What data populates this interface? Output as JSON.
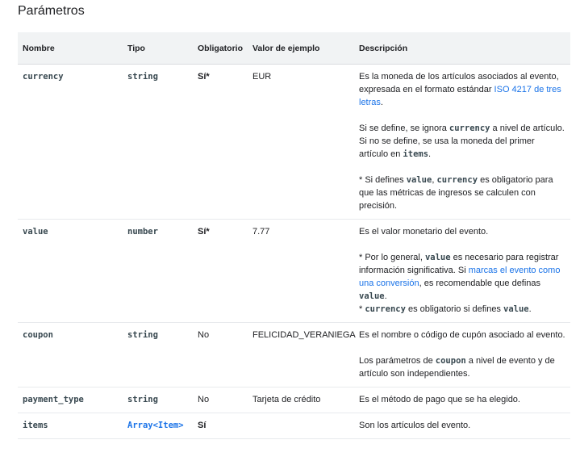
{
  "title": "Parámetros",
  "headers": {
    "name": "Nombre",
    "type": "Tipo",
    "required": "Obligatorio",
    "example": "Valor de ejemplo",
    "description": "Descripción"
  },
  "rows": [
    {
      "name": "currency",
      "type": "string",
      "required": "Sí*",
      "example": "EUR",
      "desc": {
        "p1_a": "Es la moneda de los artículos asociados al evento, expresada en el formato estándar ",
        "p1_link": "ISO 4217 de tres letras",
        "p1_b": ".",
        "p2_a": "Si se define, se ignora ",
        "p2_code1": "currency",
        "p2_b": " a nivel de artículo.",
        "p2_c": "Si no se define, se usa la moneda del primer artículo en ",
        "p2_code2": "items",
        "p2_d": ".",
        "p3_a": "* Si defines ",
        "p3_code1": "value",
        "p3_b": ", ",
        "p3_code2": "currency",
        "p3_c": " es obligatorio para que las métricas de ingresos se calculen con precisión."
      }
    },
    {
      "name": "value",
      "type": "number",
      "required": "Sí*",
      "example": "7.77",
      "desc": {
        "p1": "Es el valor monetario del evento.",
        "p2_a": "* Por lo general, ",
        "p2_code1": "value",
        "p2_b": " es necesario para registrar información significativa. Si ",
        "p2_link": "marcas el evento como una conversión",
        "p2_c": ", es recomendable que definas ",
        "p2_code2": "value",
        "p2_d": ".",
        "p2_e": "* ",
        "p2_code3": "currency",
        "p2_f": " es obligatorio si defines ",
        "p2_code4": "value",
        "p2_g": "."
      }
    },
    {
      "name": "coupon",
      "type": "string",
      "required": "No",
      "example": "FELICIDAD_VERANIEGA",
      "desc": {
        "p1": "Es el nombre o código de cupón asociado al evento.",
        "p2_a": "Los parámetros de ",
        "p2_code1": "coupon",
        "p2_b": " a nivel de evento y de artículo son independientes."
      }
    },
    {
      "name": "payment_type",
      "type": "string",
      "required": "No",
      "example": "Tarjeta de crédito",
      "desc": {
        "p1": "Es el método de pago que se ha elegido."
      }
    },
    {
      "name": "items",
      "type": "Array<Item>",
      "required": "Sí",
      "example": "",
      "desc": {
        "p1": "Son los artículos del evento."
      }
    }
  ]
}
